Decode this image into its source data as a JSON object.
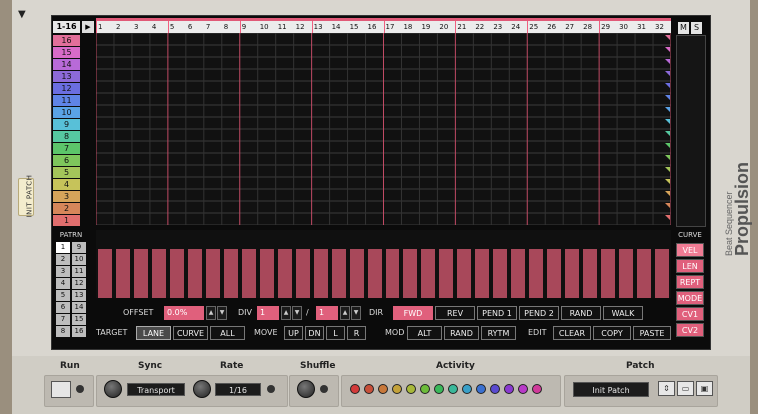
{
  "device": {
    "brand_line1": "Beat Sequencer",
    "brand_line2": "Propulsion",
    "patch_tab": "INIT PATCH",
    "collapse_glyph": "▼"
  },
  "sequencer": {
    "lane_header": "1-16",
    "play_glyph": "▶",
    "mute_label": "M",
    "solo_label": "S",
    "steps": [
      "1",
      "2",
      "3",
      "4",
      "5",
      "6",
      "7",
      "8",
      "9",
      "10",
      "11",
      "12",
      "13",
      "14",
      "15",
      "16",
      "17",
      "18",
      "19",
      "20",
      "21",
      "22",
      "23",
      "24",
      "25",
      "26",
      "27",
      "28",
      "29",
      "30",
      "31",
      "32"
    ],
    "lanes": [
      {
        "label": "16",
        "color": "#e26f9a"
      },
      {
        "label": "15",
        "color": "#d86bc8"
      },
      {
        "label": "14",
        "color": "#b86ad8"
      },
      {
        "label": "13",
        "color": "#8c6ad8"
      },
      {
        "label": "12",
        "color": "#6b6ee0"
      },
      {
        "label": "11",
        "color": "#5f84e6"
      },
      {
        "label": "10",
        "color": "#5aa3e6"
      },
      {
        "label": "9",
        "color": "#58c0d8"
      },
      {
        "label": "8",
        "color": "#56c8a0"
      },
      {
        "label": "7",
        "color": "#5cc56a"
      },
      {
        "label": "6",
        "color": "#7ec65c"
      },
      {
        "label": "5",
        "color": "#a4c55a"
      },
      {
        "label": "4",
        "color": "#c6c35a"
      },
      {
        "label": "3",
        "color": "#d6a45a"
      },
      {
        "label": "2",
        "color": "#d6865a"
      },
      {
        "label": "1",
        "color": "#e06e6e"
      }
    ],
    "pattern_label": "PATRN",
    "patterns_left": [
      "1",
      "2",
      "3",
      "4",
      "5",
      "6",
      "7",
      "8"
    ],
    "patterns_right": [
      "9",
      "10",
      "11",
      "12",
      "13",
      "14",
      "15",
      "16"
    ],
    "curve_label": "CURVE",
    "curve_buttons": [
      "VEL",
      "LEN",
      "REPT",
      "MODE",
      "CV1",
      "CV2"
    ],
    "velocity_levels": [
      0.72,
      0.72,
      0.72,
      0.72,
      0.72,
      0.72,
      0.72,
      0.72,
      0.72,
      0.72,
      0.72,
      0.72,
      0.72,
      0.72,
      0.72,
      0.72,
      0.72,
      0.72,
      0.72,
      0.72,
      0.72,
      0.72,
      0.72,
      0.72,
      0.72,
      0.72,
      0.72,
      0.72,
      0.72,
      0.72,
      0.72,
      0.72
    ]
  },
  "controls": {
    "offset_label": "OFFSET",
    "offset_value": "0.0%",
    "div_label": "DIV",
    "div_num": "1",
    "div_sep": "/",
    "div_den": "1",
    "dir_label": "DIR",
    "dir_options": [
      "FWD",
      "REV",
      "PEND 1",
      "PEND 2",
      "RAND",
      "WALK"
    ],
    "target_label": "TARGET",
    "target_options": [
      "LANE",
      "CURVE",
      "ALL"
    ],
    "move_label": "MOVE",
    "move_options": [
      "UP",
      "DN",
      "L",
      "R"
    ],
    "mod_label": "MOD",
    "mod_options": [
      "ALT",
      "RAND",
      "RYTM"
    ],
    "edit_label": "EDIT",
    "edit_options": [
      "CLEAR",
      "COPY",
      "PASTE"
    ],
    "spin_glyphs": [
      "▲",
      "▼"
    ]
  },
  "bottom": {
    "run_label": "Run",
    "sync_label": "Sync",
    "sync_value": "Transport",
    "rate_label": "Rate",
    "rate_value": "1/16",
    "shuffle_label": "Shuffle",
    "activity_label": "Activity",
    "patch_label": "Patch",
    "patch_value": "Init Patch",
    "activity_colors": [
      "#d33a3a",
      "#c8503a",
      "#c8783a",
      "#c4a23a",
      "#a8b83a",
      "#6cbc3a",
      "#3ab85a",
      "#3ab89a",
      "#3aa0c8",
      "#3a70d0",
      "#5a4ad0",
      "#8a3ad0",
      "#b83ac8",
      "#d03a9a"
    ]
  }
}
